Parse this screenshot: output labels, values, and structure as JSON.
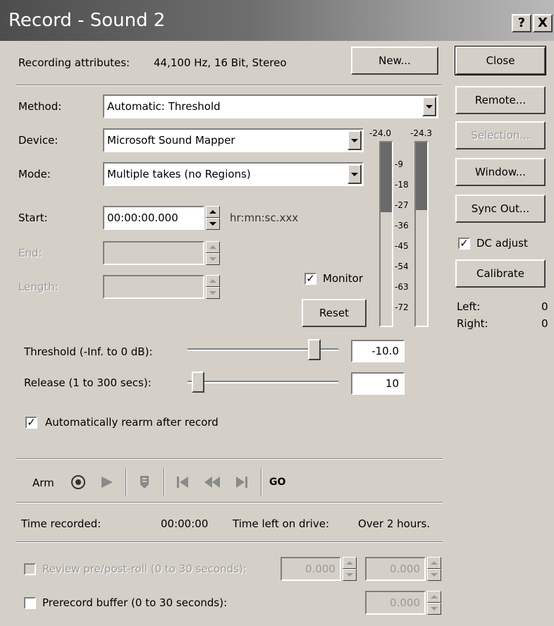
{
  "window": {
    "title": "Record - Sound 2",
    "help_label": "?",
    "close_label": "X"
  },
  "attributes": {
    "label": "Recording attributes:",
    "value": "44,100 Hz, 16 Bit, Stereo"
  },
  "buttons": {
    "new": "New...",
    "close": "Close",
    "remote": "Remote...",
    "selection": "Selection...",
    "window": "Window...",
    "sync_out": "Sync Out...",
    "calibrate": "Calibrate",
    "reset": "Reset"
  },
  "form": {
    "method_label": "Method:",
    "method_value": "Automatic: Threshold",
    "device_label": "Device:",
    "device_value": "Microsoft Sound Mapper",
    "mode_label": "Mode:",
    "mode_value": "Multiple takes (no Regions)",
    "start_label": "Start:",
    "start_value": "00:00:00.000",
    "start_unit": "hr:mn:sc.xxx",
    "end_label": "End:",
    "end_value": "",
    "length_label": "Length:",
    "length_value": ""
  },
  "monitor": {
    "label": "Monitor",
    "checked": true
  },
  "dc_adjust": {
    "label": "DC adjust",
    "checked": true
  },
  "levels": {
    "left_peak": "-24.0",
    "right_peak": "-24.3",
    "scale": [
      "9",
      "18",
      "27",
      "36",
      "45",
      "54",
      "63",
      "72"
    ],
    "left_level_fraction": 0.38,
    "right_level_fraction": 0.37,
    "left_label": "Left:",
    "left_value": "0",
    "right_label": "Right:",
    "right_value": "0"
  },
  "threshold": {
    "label": "Threshold (-Inf. to 0 dB):",
    "value": "-10.0",
    "slider_fraction": 0.87
  },
  "release": {
    "label": "Release (1 to 300 secs):",
    "value": "10",
    "slider_fraction": 0.03
  },
  "auto_rearm": {
    "label": "Automatically rearm after record",
    "checked": true
  },
  "transport": {
    "arm_label": "Arm",
    "go_label": "GO",
    "icons": [
      "record-icon",
      "play-icon",
      "marker-icon",
      "go-to-start-icon",
      "rewind-icon",
      "go-to-end-icon"
    ]
  },
  "status": {
    "time_recorded_label": "Time recorded:",
    "time_recorded_value": "00:00:00",
    "time_left_label": "Time left on drive:",
    "time_left_value": "Over 2 hours."
  },
  "review": {
    "label": "Review pre/post-roll (0 to 30 seconds):",
    "checked": false,
    "pre_value": "0.000",
    "post_value": "0.000"
  },
  "prerecord": {
    "label": "Prerecord buffer (0 to 30 seconds):",
    "checked": false,
    "value": "0.000"
  },
  "colors": {
    "face": "#d4d0c8",
    "title_gradient_start": "#4d4d4d",
    "title_gradient_end": "#b9b9b9",
    "meter_fill": "#6a6a6a"
  }
}
